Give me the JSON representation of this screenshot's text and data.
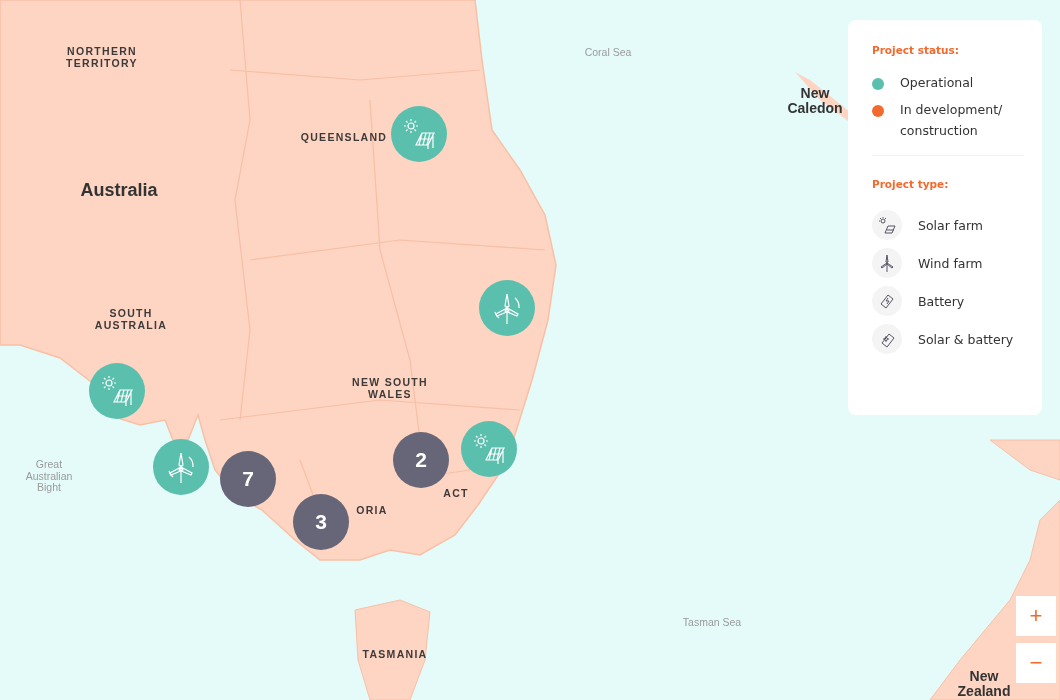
{
  "map": {
    "labels": [
      {
        "kind": "region",
        "text": "NORTHERN TERRITORY"
      },
      {
        "kind": "region",
        "text": "QUEENSLAND"
      },
      {
        "kind": "continent",
        "text": "Australia"
      },
      {
        "kind": "region",
        "text": "SOUTH AUSTRALIA"
      },
      {
        "kind": "region",
        "text": "NEW SOUTH WALES"
      },
      {
        "kind": "region",
        "text": "ACT"
      },
      {
        "kind": "region",
        "text": "ORIA"
      },
      {
        "kind": "region",
        "text": "TASMANIA"
      },
      {
        "kind": "sea",
        "text": "Great Australian Bight"
      },
      {
        "kind": "sea",
        "text": "Coral Sea"
      },
      {
        "kind": "sea",
        "text": "Tasman Sea"
      },
      {
        "kind": "country",
        "text": "New Caledon"
      },
      {
        "kind": "country",
        "text": "New Zealand"
      }
    ],
    "markers": [
      {
        "kind": "solar",
        "color": "#5bbfae"
      },
      {
        "kind": "wind",
        "color": "#5bbfae"
      },
      {
        "kind": "solar",
        "color": "#5bbfae"
      },
      {
        "kind": "wind",
        "color": "#5bbfae"
      },
      {
        "kind": "cluster",
        "color": "#666678",
        "count": "7"
      },
      {
        "kind": "cluster",
        "color": "#666678",
        "count": "3"
      },
      {
        "kind": "cluster",
        "color": "#666678",
        "count": "2"
      },
      {
        "kind": "solar",
        "color": "#5bbfae"
      }
    ],
    "zoom_in": "+",
    "zoom_out": "−"
  },
  "legend": {
    "status_title": "Project status:",
    "statuses": [
      {
        "label": "Operational",
        "color": "#5bbfae"
      },
      {
        "label": "In development/ construction",
        "color": "#f26a2e"
      }
    ],
    "type_title": "Project type:",
    "types": [
      {
        "kind": "solar",
        "label": "Solar farm"
      },
      {
        "kind": "wind",
        "label": "Wind farm"
      },
      {
        "kind": "battery",
        "label": "Battery"
      },
      {
        "kind": "solar-battery",
        "label": "Solar & battery"
      }
    ]
  }
}
